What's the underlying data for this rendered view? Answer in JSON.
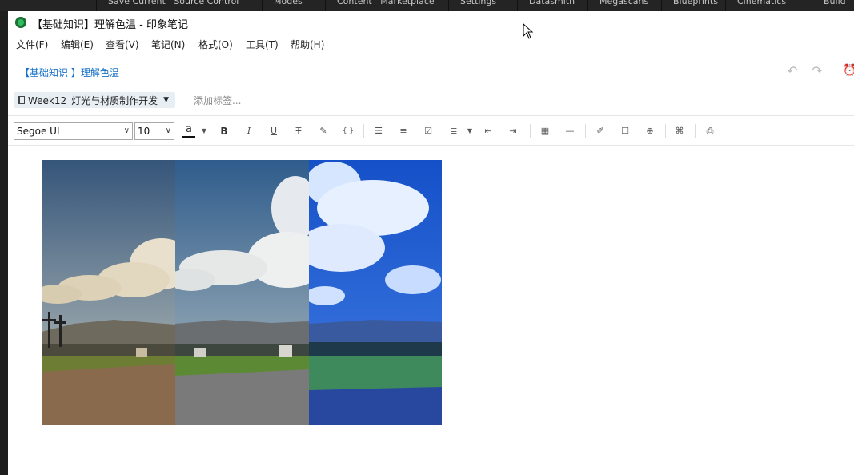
{
  "background_app": {
    "toolbar_items": [
      "Save Current",
      "Source Control",
      "Modes",
      "Content",
      "Marketplace",
      "Settings",
      "Datasmith",
      "Megascans",
      "Blueprints",
      "Cinematics",
      "Build"
    ]
  },
  "window": {
    "title": "【基础知识】理解色温 - 印象笔记"
  },
  "menu": [
    "文件(F)",
    "编辑(E)",
    "查看(V)",
    "笔记(N)",
    "格式(O)",
    "工具(T)",
    "帮助(H)"
  ],
  "note": {
    "title": "【基础知识 】理解色温",
    "notebook": "Week12_灯光与材质制作开发",
    "tag_placeholder": "添加标签..."
  },
  "toolbar": {
    "font_family": "Segoe UI",
    "font_size": "10",
    "text_color_glyph": "a",
    "bold": "B",
    "italic": "I",
    "underline": "U",
    "strikethrough": "T",
    "code": "{ }"
  },
  "colors": {
    "link_blue": "#1a73c8",
    "notebook_chip_bg": "#e7eef4",
    "app_icon_green": "#2dbe60"
  }
}
